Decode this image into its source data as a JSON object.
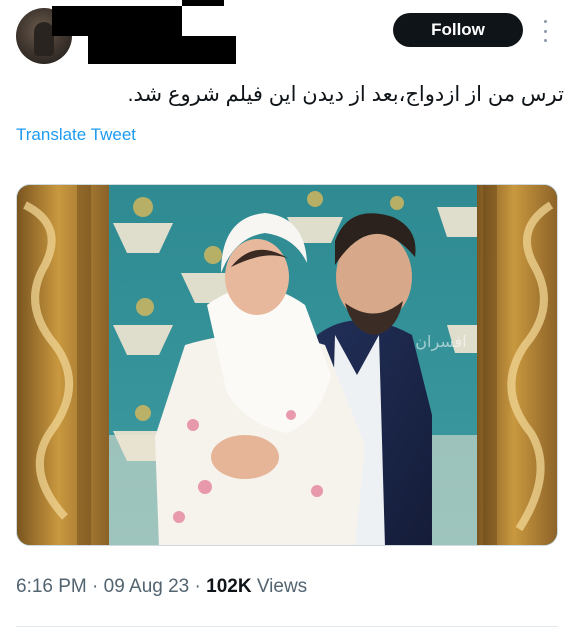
{
  "tweet": {
    "follow_label": "Follow",
    "text": "ترس من از ازدواج،بعد از دیدن این فیلم شروع شد.",
    "translate_label": "Translate Tweet",
    "time": "6:16 PM",
    "date": "09 Aug 23",
    "views_count": "102K",
    "views_label": "Views",
    "separator": "·"
  },
  "media": {
    "watermark": "افسران"
  },
  "icons": {
    "more": "more-vertical-icon",
    "avatar": "avatar"
  },
  "colors": {
    "follow_bg": "#0f1419",
    "link": "#1d9bf0",
    "meta": "#536471"
  }
}
